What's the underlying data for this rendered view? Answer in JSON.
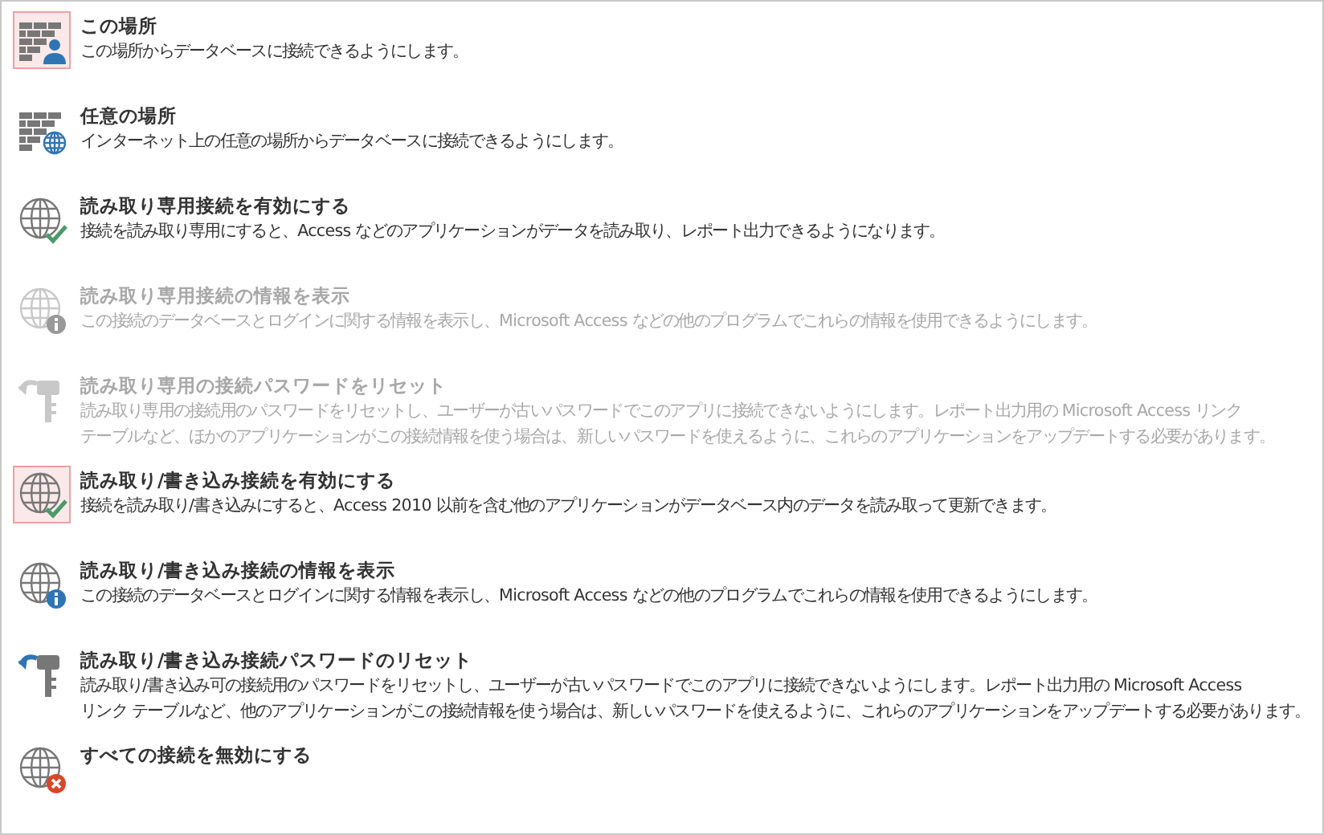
{
  "commands": [
    {
      "kind": "wall-user",
      "title": "この場所",
      "description": [
        "この場所からデータベースに接続できるようにします。"
      ],
      "selected": true,
      "disabled": false
    },
    {
      "kind": "wall-globe",
      "title": "任意の場所",
      "description": [
        "インターネット上の任意の場所からデータベースに接続できるようにします。"
      ],
      "selected": false,
      "disabled": false
    },
    {
      "kind": "globe-check",
      "title": "読み取り専用接続を有効にする",
      "description": [
        "接続を読み取り専用にすると、Access などのアプリケーションがデータを読み取り、レポート出力できるようになります。"
      ],
      "selected": false,
      "disabled": false
    },
    {
      "kind": "globe-info",
      "title": "読み取り専用接続の情報を表示",
      "description": [
        "この接続のデータベースとログインに関する情報を表示し、Microsoft Access などの他のプログラムでこれらの情報を使用できるようにします。"
      ],
      "selected": false,
      "disabled": true
    },
    {
      "kind": "key-reset",
      "title": "読み取り専用の接続パスワードをリセット",
      "description": [
        "読み取り専用の接続用のパスワードをリセットし、ユーザーが古いパスワードでこのアプリに接続できないようにします。レポート出力用の Microsoft Access リンク",
        "テーブルなど、ほかのアプリケーションがこの接続情報を使う場合は、新しいパスワードを使えるように、これらのアプリケーションをアップデートする必要があります。"
      ],
      "selected": false,
      "disabled": true
    },
    {
      "kind": "globe-check",
      "title": "読み取り/書き込み接続を有効にする",
      "description": [
        "接続を読み取り/書き込みにすると、Access 2010 以前を含む他のアプリケーションがデータベース内のデータを読み取って更新できます。"
      ],
      "selected": true,
      "disabled": false
    },
    {
      "kind": "globe-info",
      "title": "読み取り/書き込み接続の情報を表示",
      "description": [
        "この接続のデータベースとログインに関する情報を表示し、Microsoft Access などの他のプログラムでこれらの情報を使用できるようにします。"
      ],
      "selected": false,
      "disabled": false
    },
    {
      "kind": "key-reset",
      "title": "読み取り/書き込み接続パスワードのリセット",
      "description": [
        "読み取り/書き込み可の接続用のパスワードをリセットし、ユーザーが古いパスワードでこのアプリに接続できないようにします。レポート出力用の Microsoft Access",
        "リンク テーブルなど、他のアプリケーションがこの接続情報を使う場合は、新しいパスワードを使えるように、これらのアプリケーションをアップデートする必要があります。"
      ],
      "selected": false,
      "disabled": false
    },
    {
      "kind": "globe-x",
      "title": "すべての接続を無効にする",
      "selected": false,
      "disabled": false
    }
  ]
}
